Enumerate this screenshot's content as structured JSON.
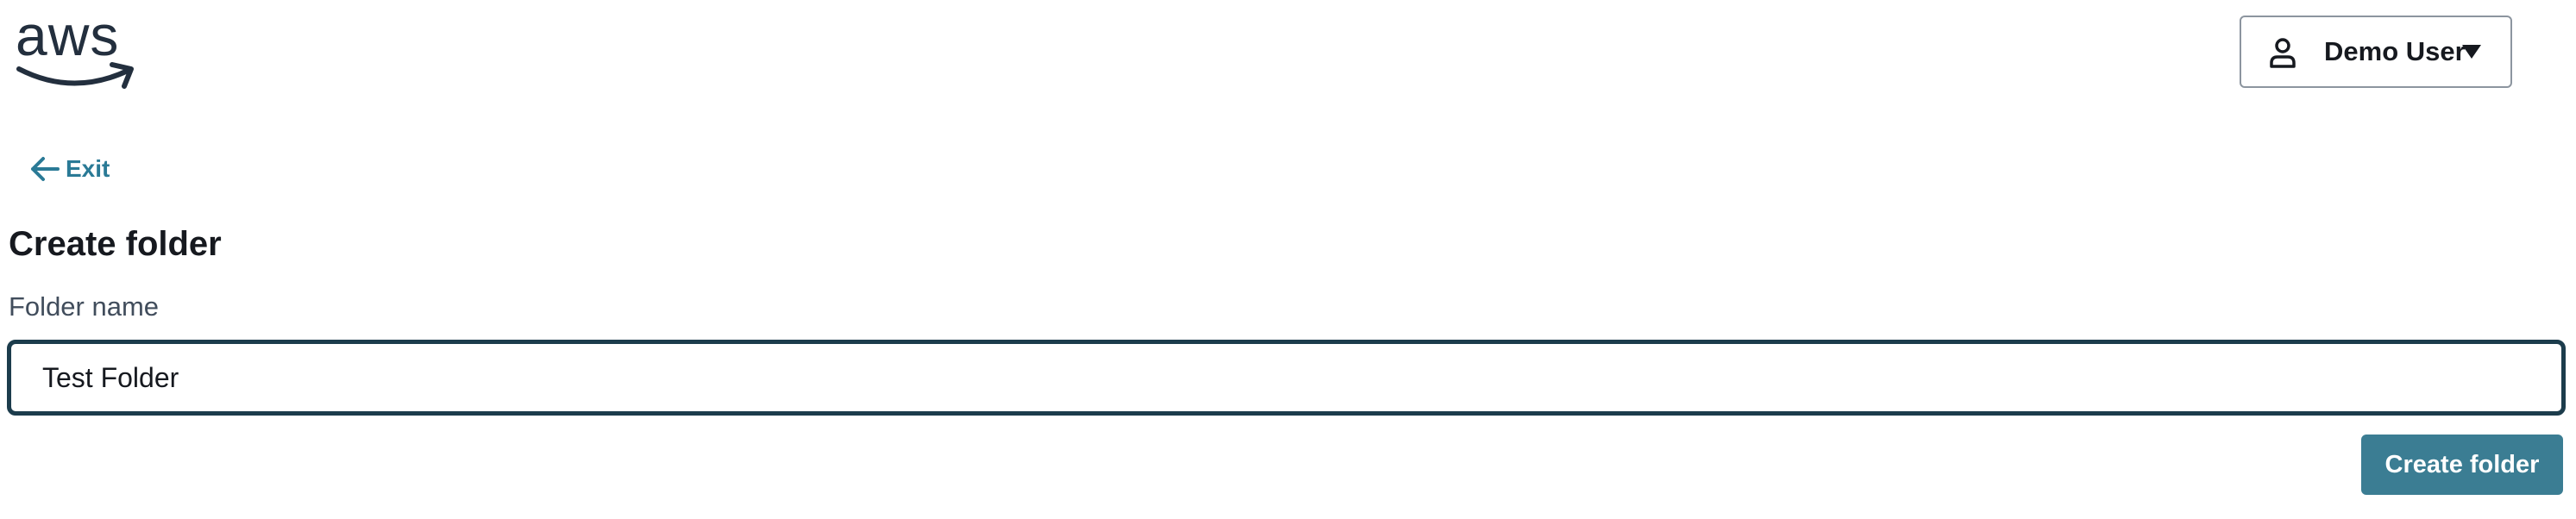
{
  "header": {
    "logo_text": "aws",
    "logo_icon": "aws-smile-arrow",
    "user_menu": {
      "icon": "user-icon",
      "name": "Demo User",
      "caret_icon": "caret-down-icon"
    }
  },
  "navigation": {
    "exit_label": "Exit",
    "exit_icon": "arrow-left-icon"
  },
  "form": {
    "title": "Create folder",
    "folder_name_label": "Folder name",
    "folder_name_value": "Test Folder",
    "submit_label": "Create folder"
  },
  "colors": {
    "accent": "#3b7d93",
    "link": "#2a7a96",
    "input_border": "#1c3c4c",
    "text": "#16191f"
  }
}
